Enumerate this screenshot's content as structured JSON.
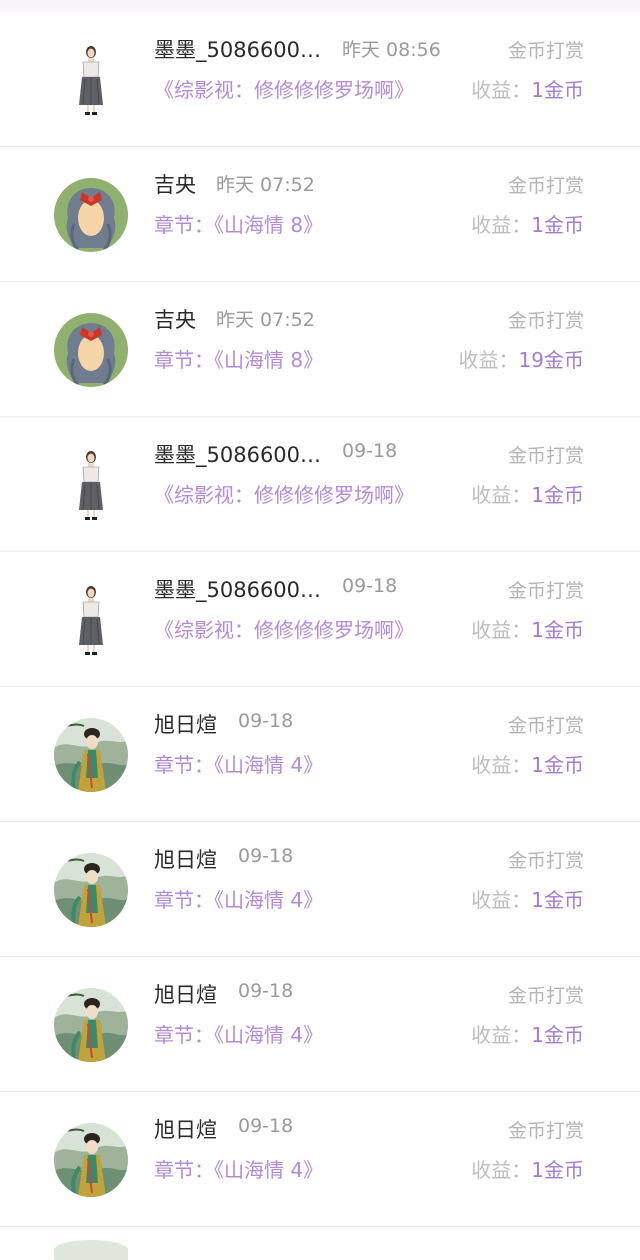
{
  "reward_type": "金币打赏",
  "income_label": "收益：",
  "colors": {
    "purple_text": "#b48ad6",
    "purple_value": "#a57bd0",
    "gray_text": "#9a9a9a"
  },
  "rows": [
    {
      "avatar": "fashion-figure",
      "name": "墨墨_5086600…",
      "time": "昨天 08:56",
      "chapter": "《综影视：修修修修罗场啊》",
      "income": "1金币"
    },
    {
      "avatar": "green-cartoon",
      "name": "吉央",
      "time": "昨天 07:52",
      "chapter": "章节：《山海情 8》",
      "income": "1金币"
    },
    {
      "avatar": "green-cartoon",
      "name": "吉央",
      "time": "昨天 07:52",
      "chapter": "章节：《山海情 8》",
      "income": "19金币"
    },
    {
      "avatar": "fashion-figure",
      "name": "墨墨_5086600…",
      "time": "09-18",
      "chapter": "《综影视：修修修修罗场啊》",
      "income": "1金币"
    },
    {
      "avatar": "fashion-figure",
      "name": "墨墨_5086600…",
      "time": "09-18",
      "chapter": "《综影视：修修修修罗场啊》",
      "income": "1金币"
    },
    {
      "avatar": "painting",
      "name": "旭日煊",
      "time": "09-18",
      "chapter": "章节：《山海情 4》",
      "income": "1金币"
    },
    {
      "avatar": "painting",
      "name": "旭日煊",
      "time": "09-18",
      "chapter": "章节：《山海情 4》",
      "income": "1金币"
    },
    {
      "avatar": "painting",
      "name": "旭日煊",
      "time": "09-18",
      "chapter": "章节：《山海情 4》",
      "income": "1金币"
    },
    {
      "avatar": "painting",
      "name": "旭日煊",
      "time": "09-18",
      "chapter": "章节：《山海情 4》",
      "income": "1金币"
    }
  ]
}
